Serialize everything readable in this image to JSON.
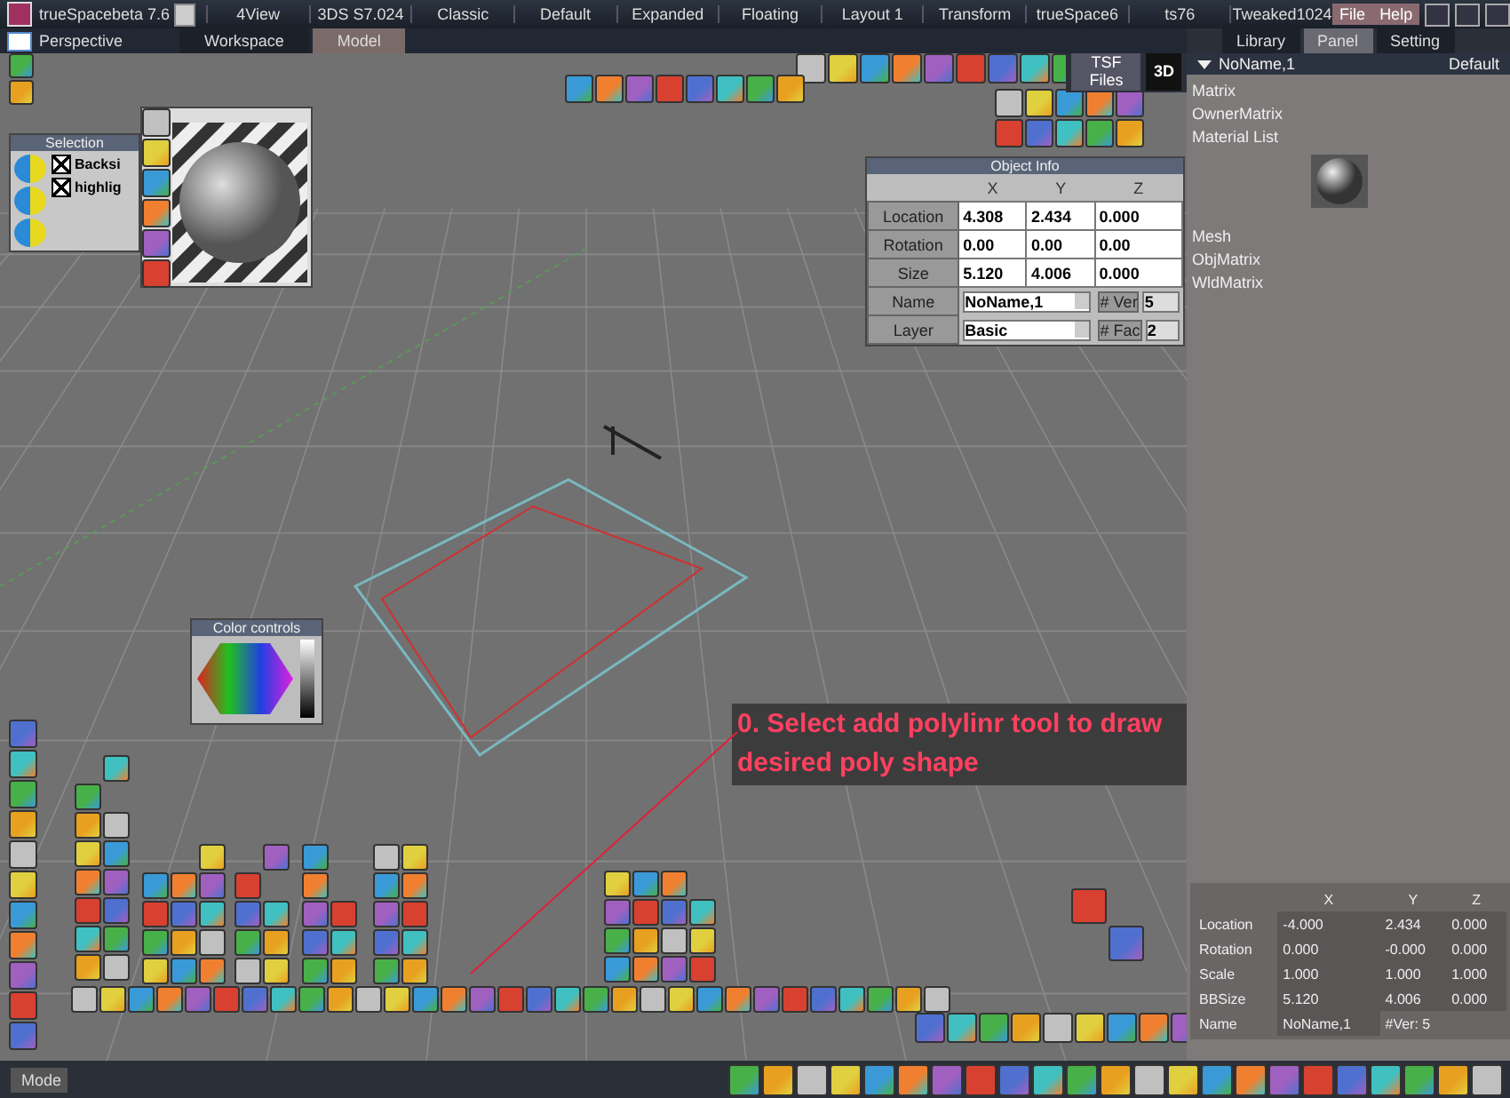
{
  "title_bar": {
    "app_title": "trueSpacebeta 7.6",
    "layouts": [
      "4View",
      "3DS S7.024",
      "Classic",
      "Default",
      "Expanded",
      "Floating",
      "Layout 1",
      "Transform",
      "trueSpace6",
      "ts76",
      "Tweaked1024"
    ],
    "menus": [
      "File",
      "Help"
    ]
  },
  "view_tabs": [
    {
      "label": "Perspective",
      "selected": false
    },
    {
      "label": "Workspace",
      "selected": false
    },
    {
      "label": "Model",
      "selected": true
    }
  ],
  "viewport_toolbar": {
    "file_dropdown": "TSF Files",
    "view_mode": "3D"
  },
  "object_info": {
    "title": "Object Info",
    "columns": [
      "X",
      "Y",
      "Z"
    ],
    "rows": [
      {
        "label": "Location",
        "values": [
          "4.308",
          "2.434",
          "0.000"
        ]
      },
      {
        "label": "Rotation",
        "values": [
          "0.00",
          "0.00",
          "0.00"
        ]
      },
      {
        "label": "Size",
        "values": [
          "5.120",
          "4.006",
          "0.000"
        ]
      }
    ],
    "name_label": "Name",
    "name": "NoName,1",
    "vertices_label": "# Ver",
    "vertices": "5",
    "layer_label": "Layer",
    "layer": "Basic",
    "faces_label": "# Fac",
    "faces": "2"
  },
  "selection_panel": {
    "title": "Selection",
    "options": [
      {
        "label": "Backsi",
        "checked": true
      },
      {
        "label": "highlig",
        "checked": true
      }
    ]
  },
  "color_panel": {
    "title": "Color controls"
  },
  "annotation": "0. Select add polylinr tool to draw desired poly shape",
  "right_panel": {
    "tabs": [
      {
        "label": "Library",
        "selected": false
      },
      {
        "label": "Panel",
        "selected": true
      },
      {
        "label": "Setting",
        "selected": false
      }
    ],
    "object_name": "NoName,1",
    "preset": "Default",
    "material_attributes": [
      "Matrix",
      "OwnerMatrix",
      "Material List"
    ],
    "mesh_attributes": [
      "Mesh",
      "ObjMatrix",
      "WldMatrix"
    ]
  },
  "transform_panel": {
    "columns": [
      "X",
      "Y",
      "Z"
    ],
    "rows": [
      {
        "label": "Location",
        "values": [
          "-4.000",
          "2.434",
          "0.000"
        ]
      },
      {
        "label": "Rotation",
        "values": [
          "0.000",
          "-0.000",
          "0.000"
        ]
      },
      {
        "label": "Scale",
        "values": [
          "1.000",
          "1.000",
          "1.000"
        ]
      },
      {
        "label": "BBSize",
        "values": [
          "5.120",
          "4.006",
          "0.000"
        ]
      }
    ],
    "name_label": "Name",
    "name": "NoName,1",
    "vertices": "#Ver: 5"
  },
  "status_bar": {
    "mode_label": "Mode"
  }
}
